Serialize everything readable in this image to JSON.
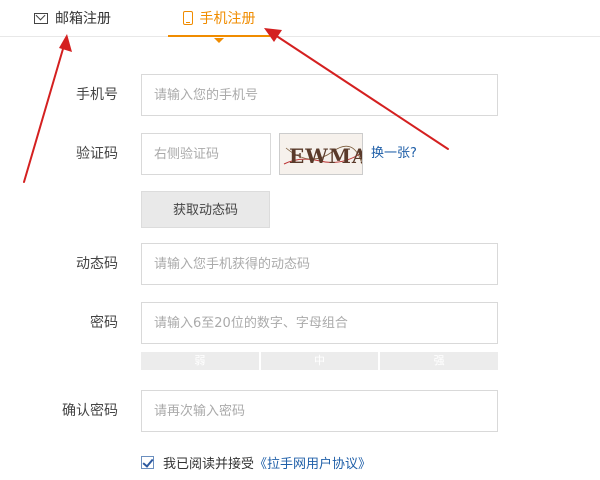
{
  "tabs": {
    "email_label": "邮箱注册",
    "phone_label": "手机注册"
  },
  "form": {
    "phone": {
      "label": "手机号",
      "placeholder": "请输入您的手机号"
    },
    "captcha": {
      "label": "验证码",
      "placeholder": "右侧验证码",
      "image_text": "EWMA",
      "change_link": "换一张?"
    },
    "get_code_button": "获取动态码",
    "dynamic_code": {
      "label": "动态码",
      "placeholder": "请输入您手机获得的动态码"
    },
    "password": {
      "label": "密码",
      "placeholder": "请输入6至20位的数字、字母组合"
    },
    "strength": [
      "弱",
      "中",
      "强"
    ],
    "confirm_password": {
      "label": "确认密码",
      "placeholder": "请再次输入密码"
    },
    "agreement": {
      "prefix": "我已阅读并接受",
      "link": "《拉手网用户协议》",
      "checked": true
    }
  },
  "colors": {
    "accent": "#f08c00",
    "link": "#1f5fa8",
    "annotation": "#d42020"
  }
}
